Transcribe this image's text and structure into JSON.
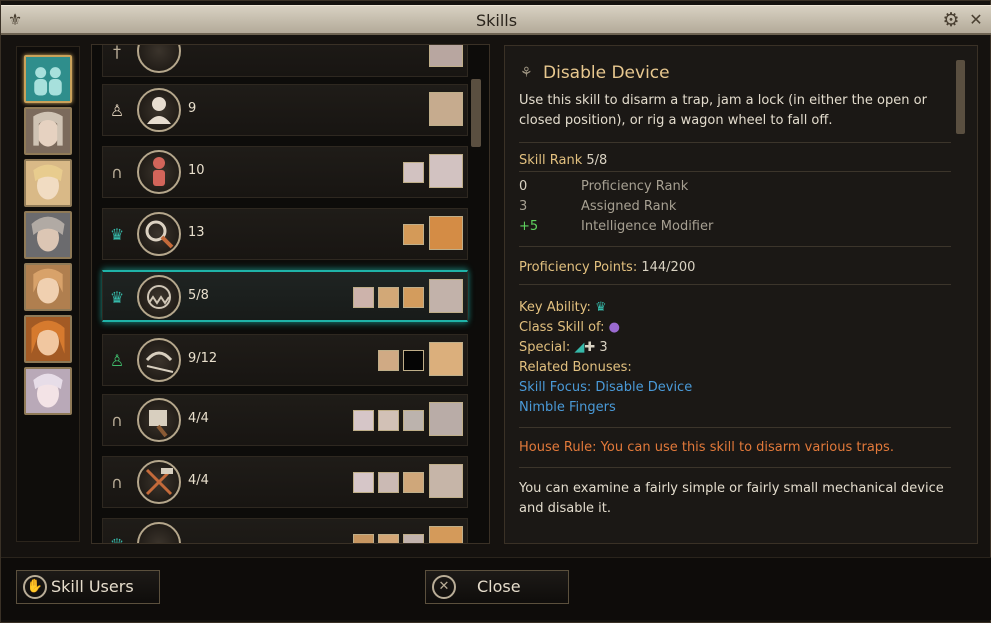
{
  "window": {
    "title": "Skills"
  },
  "party": [
    {
      "name": "party",
      "selected": true,
      "color": "#3aa6a3"
    },
    {
      "name": "elf-pale",
      "color": "#c9b9a6"
    },
    {
      "name": "elf-blonde",
      "color": "#e2c49a"
    },
    {
      "name": "elf-hood",
      "color": "#a8a09a"
    },
    {
      "name": "elf-braid",
      "color": "#caa07a"
    },
    {
      "name": "elf-red",
      "color": "#d9904e"
    },
    {
      "name": "elf-white",
      "color": "#d7cbd6"
    }
  ],
  "skills": [
    {
      "rank": "",
      "icon": "sword-icon"
    },
    {
      "rank": "9",
      "icon": "figure-icon"
    },
    {
      "rank": "10",
      "icon": "horseshoe-icon"
    },
    {
      "rank": "13",
      "icon": "crown-icon"
    },
    {
      "rank": "5/8",
      "icon": "crown-icon",
      "selected": true
    },
    {
      "rank": "9/12",
      "icon": "figure-icon"
    },
    {
      "rank": "4/4",
      "icon": "horseshoe-icon"
    },
    {
      "rank": "4/4",
      "icon": "horseshoe-icon"
    },
    {
      "rank": "",
      "icon": "crown-icon"
    }
  ],
  "detail": {
    "title": "Disable Device",
    "description": "Use this skill to disarm a trap, jam a lock (in either the open or closed position), or rig a wagon wheel to fall off.",
    "skill_rank_label": "Skill Rank",
    "skill_rank_value": "5/8",
    "breakdown": [
      {
        "value": "0",
        "label": "Proficiency Rank"
      },
      {
        "value": "3",
        "label": "Assigned Rank"
      },
      {
        "value": "+5",
        "label": "Intelligence Modifier"
      }
    ],
    "points_label": "Proficiency Points:",
    "points_value": "144/200",
    "key_ability_label": "Key Ability:",
    "class_skill_label": "Class Skill of:",
    "special_label": "Special:",
    "special_value": "3",
    "related_label": "Related Bonuses:",
    "related": [
      "Skill Focus: Disable Device",
      "Nimble Fingers"
    ],
    "house_rule": "House Rule: You can use this skill to disarm various traps.",
    "extra": "You can examine a fairly simple or fairly small mechanical device and disable it."
  },
  "buttons": {
    "skill_users": "Skill Users",
    "close": "Close"
  }
}
